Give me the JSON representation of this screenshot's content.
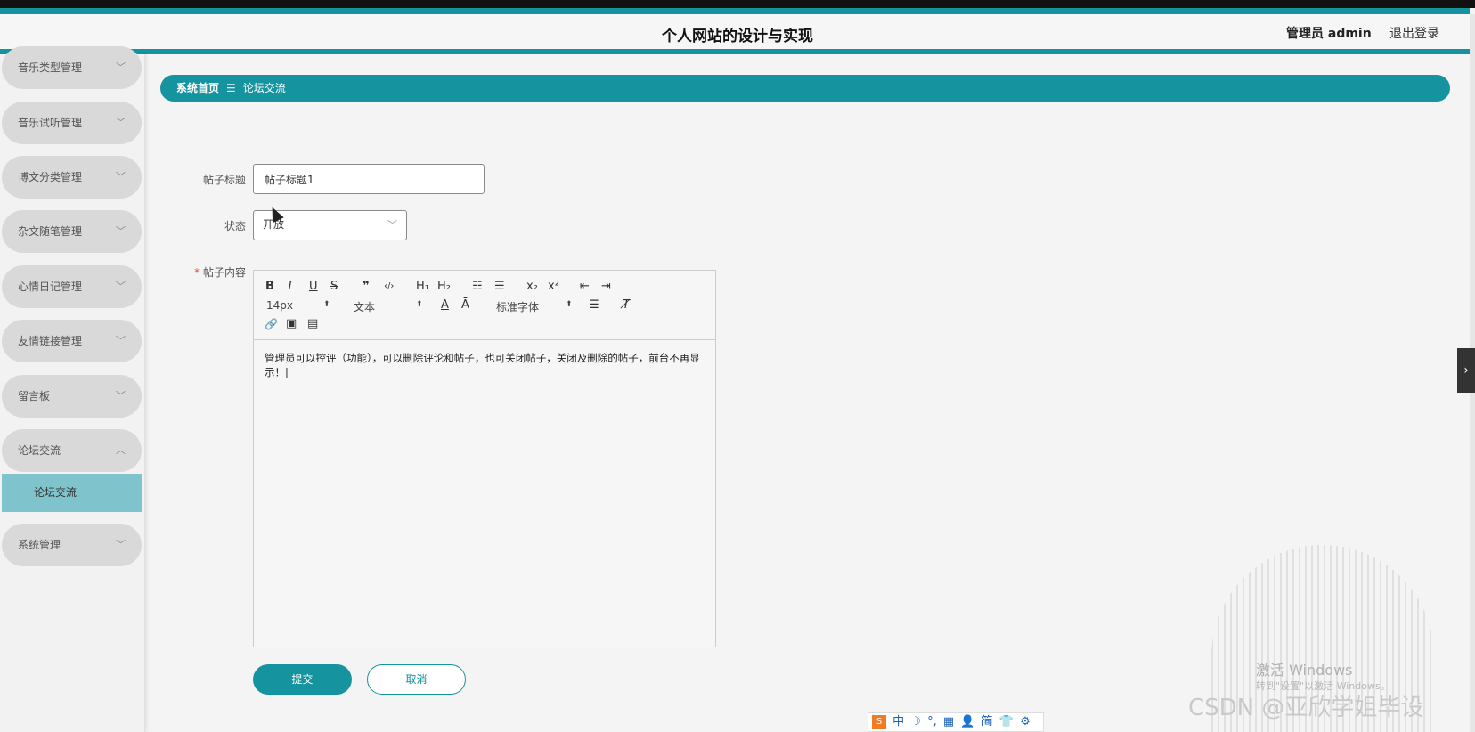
{
  "header": {
    "title": "个人网站的设计与实现",
    "user": "管理员 admin",
    "logout": "退出登录"
  },
  "sidebar": {
    "items": [
      {
        "label": "音乐类型管理",
        "chevron": "﹀"
      },
      {
        "label": "音乐试听管理",
        "chevron": "﹀"
      },
      {
        "label": "博文分类管理",
        "chevron": "﹀"
      },
      {
        "label": "杂文随笔管理",
        "chevron": "﹀"
      },
      {
        "label": "心情日记管理",
        "chevron": "﹀"
      },
      {
        "label": "友情链接管理",
        "chevron": "﹀"
      },
      {
        "label": "留言板",
        "chevron": "﹀"
      },
      {
        "label": "论坛交流",
        "chevron": "︿"
      },
      {
        "label": "系统管理",
        "chevron": "﹀"
      }
    ],
    "sub_item": "论坛交流"
  },
  "breadcrumb": {
    "home": "系统首页",
    "sep": "☰",
    "current": "论坛交流"
  },
  "form": {
    "title_label": "帖子标题",
    "title_value": "帖子标题1",
    "status_label": "状态",
    "status_value": "开放",
    "content_label": "帖子内容",
    "required_mark": "*",
    "content_text": "管理员可以控评（功能），可以删除评论和帖子，也可关闭帖子，关闭及删除的帖子，前台不再显示！|"
  },
  "editor": {
    "size": "14px",
    "header_type": "文本",
    "font": "标准字体",
    "toolbar": {
      "bold": "B",
      "italic": "I",
      "underline": "U",
      "strike": "S",
      "quote": "❞",
      "code": "‹/›",
      "h1": "H₁",
      "h2": "H₂",
      "ol": "☷",
      "ul": "☰",
      "sub": "x₂",
      "sup": "x²",
      "outdent": "⇤",
      "indent": "⇥",
      "color": "A",
      "background": "Ā",
      "align": "☰",
      "clean": "T̸",
      "link": "🔗",
      "image": "▣",
      "video": "▤",
      "select_arrow": "⬍"
    }
  },
  "buttons": {
    "submit": "提交",
    "cancel": "取消"
  },
  "misc": {
    "side_tab": "›",
    "win_activate": "激活 Windows",
    "win_goto": "转到\"设置\"以激活 Windows。",
    "csdn": "CSDN @亚欣学姐毕设",
    "ime_logo": "S",
    "ime_items": [
      "中",
      "☽",
      "°,",
      "▦",
      "👤",
      "简",
      "👕",
      "⚙"
    ],
    "ime_tiktok": "♪"
  },
  "colors": {
    "accent": "#15939f",
    "menu_bg": "#d9d9d9",
    "sub_active": "#7fc4cc"
  }
}
